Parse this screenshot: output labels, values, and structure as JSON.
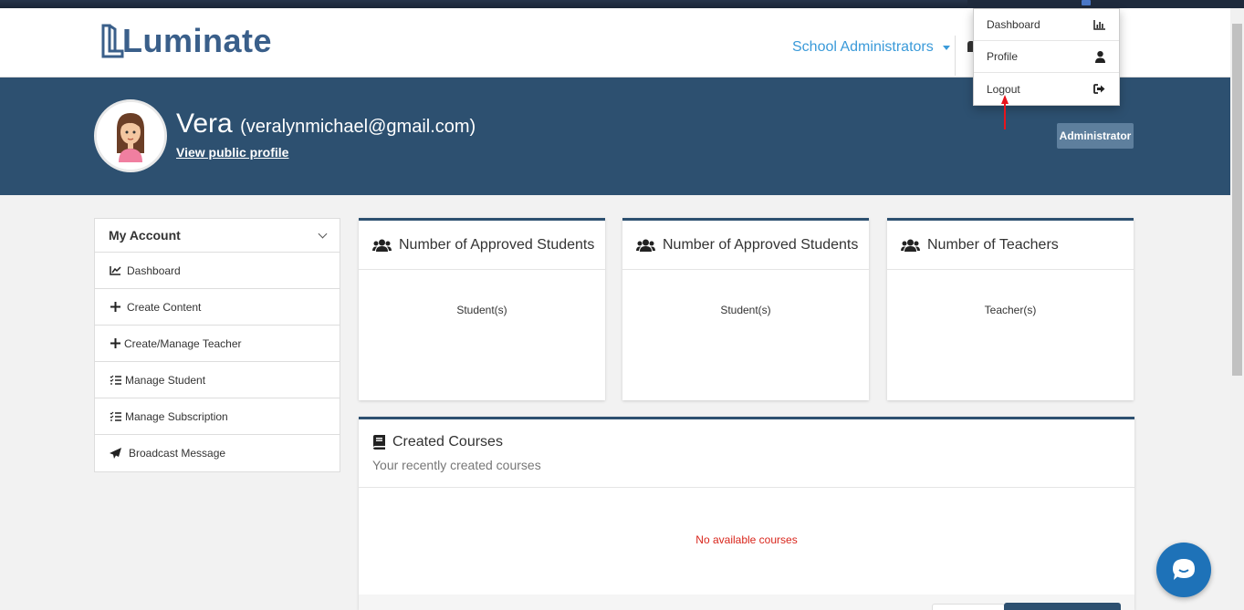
{
  "header": {
    "logo_text": "Luminate",
    "role_menu_label": "School Administrators"
  },
  "user_menu": {
    "items": [
      {
        "label": "Dashboard",
        "icon": "bar-chart-icon"
      },
      {
        "label": "Profile",
        "icon": "user-icon"
      },
      {
        "label": "Logout",
        "icon": "sign-out-icon"
      }
    ]
  },
  "profile": {
    "name": "Vera",
    "email": "(veralynmichael@gmail.com)",
    "public_link": "View public profile",
    "role_badge": "Administrator"
  },
  "sidebar": {
    "title": "My Account",
    "items": [
      {
        "label": "Dashboard",
        "icon": "line-chart-icon"
      },
      {
        "label": "Create Content",
        "icon": "plus-icon"
      },
      {
        "label": "Create/Manage Teacher",
        "icon": "plus-icon"
      },
      {
        "label": "Manage Student",
        "icon": "checklist-icon"
      },
      {
        "label": "Manage Subscription",
        "icon": "checklist-icon"
      },
      {
        "label": "Broadcast Message",
        "icon": "paper-plane-icon"
      }
    ]
  },
  "stats": [
    {
      "title": "Number of Approved Students",
      "unit": "Student(s)",
      "icon": "users-icon"
    },
    {
      "title": "Number of Approved Students",
      "unit": "Student(s)",
      "icon": "users-icon"
    },
    {
      "title": "Number of Teachers",
      "unit": "Teacher(s)",
      "icon": "users-icon"
    }
  ],
  "courses": {
    "title": "Created Courses",
    "subtitle": "Your recently created courses",
    "empty_message": "No available courses",
    "icon": "book-icon"
  },
  "colors": {
    "primary": "#2d5070",
    "link": "#3a9ad9",
    "error": "#d9261c",
    "chat": "#1e72b8"
  }
}
